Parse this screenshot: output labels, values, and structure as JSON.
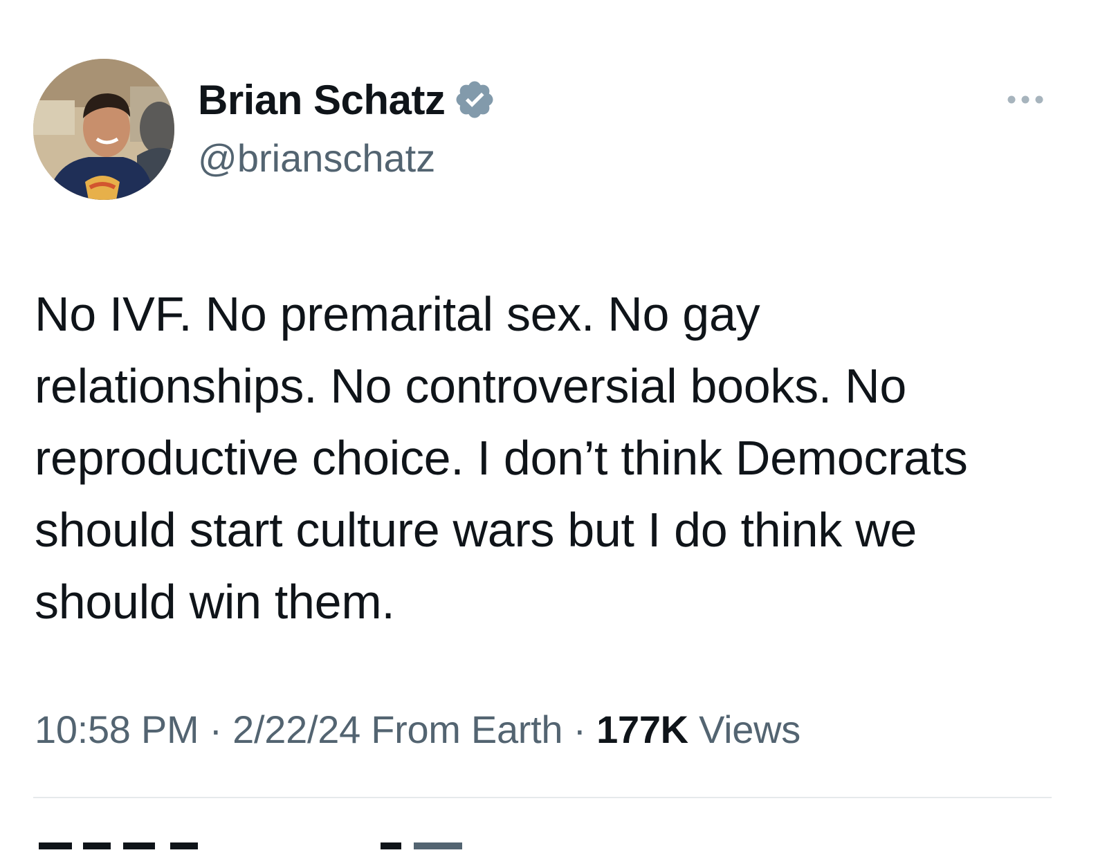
{
  "author": {
    "display_name": "Brian Schatz",
    "handle": "@brianschatz",
    "verified": true,
    "verified_badge_color": "#829aab"
  },
  "tweet": {
    "text": "No IVF. No premarital sex. No gay relationships. No controversial books. No reproductive choice. I don’t think Democrats should start culture wars but I do think we should win them."
  },
  "meta": {
    "time": "10:58 PM",
    "separator": " · ",
    "date": "2/22/24",
    "source": "From Earth",
    "views_count": "177K",
    "views_label": "Views"
  },
  "icons": {
    "more": "more-horizontal-icon",
    "verified": "verified-badge-icon"
  },
  "colors": {
    "text_primary": "#0f1419",
    "text_secondary": "#536471",
    "divider": "#e6e9eb"
  }
}
